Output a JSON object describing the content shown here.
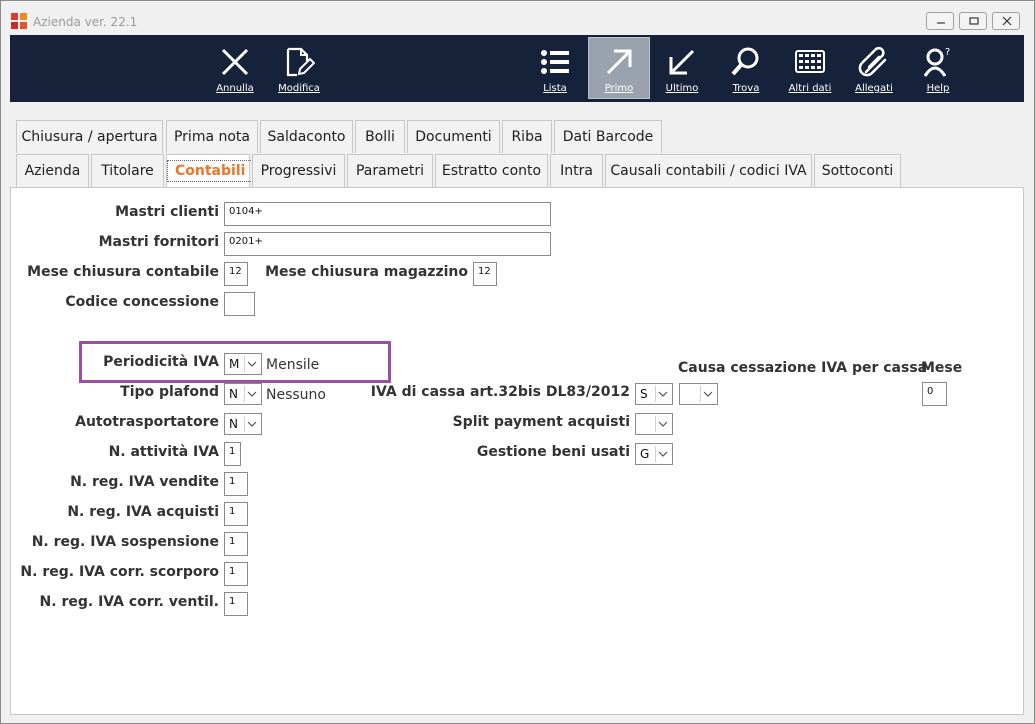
{
  "window": {
    "title": "Azienda ver. 22.1",
    "controls": {
      "minimize": "minimize-icon",
      "restore": "restore-icon",
      "close": "close-icon"
    }
  },
  "toolbar": {
    "annulla": "Annulla",
    "modifica": "Modifica",
    "lista": "Lista",
    "primo": "Primo",
    "ultimo": "Ultimo",
    "trova": "Trova",
    "altri_dati": "Altri dati",
    "allegati": "Allegati",
    "help": "Help",
    "active": "Primo"
  },
  "tabs_row1": [
    "Chiusura / apertura",
    "Prima nota",
    "Saldaconto",
    "Bolli",
    "Documenti",
    "Riba",
    "Dati Barcode"
  ],
  "tabs_row2": [
    "Azienda",
    "Titolare",
    "Contabili",
    "Progressivi",
    "Parametri",
    "Estratto conto",
    "Intra",
    "Causali contabili / codici IVA",
    "Sottoconti"
  ],
  "active_tab": "Contabili",
  "form": {
    "mastri_clienti": {
      "label": "Mastri clienti",
      "value": "0104+"
    },
    "mastri_fornitori": {
      "label": "Mastri fornitori",
      "value": "0201+"
    },
    "mese_chiusura_contabile": {
      "label": "Mese chiusura contabile",
      "value": "12"
    },
    "mese_chiusura_magazzino": {
      "label": "Mese chiusura magazzino",
      "value": "12"
    },
    "codice_concessione": {
      "label": "Codice concessione",
      "value": ""
    },
    "periodicita_iva": {
      "label": "Periodicità IVA",
      "value": "M",
      "description": "Mensile"
    },
    "tipo_plafond": {
      "label": "Tipo plafond",
      "value": "N",
      "description": "Nessuno"
    },
    "autotrasportatore": {
      "label": "Autotrasportatore",
      "value": "N"
    },
    "n_attivita_iva": {
      "label": "N. attività IVA",
      "value": "1"
    },
    "n_reg_iva_vendite": {
      "label": "N. reg. IVA vendite",
      "value": "1"
    },
    "n_reg_iva_acquisti": {
      "label": "N. reg. IVA acquisti",
      "value": "1"
    },
    "n_reg_iva_sospensione": {
      "label": "N. reg. IVA sospensione",
      "value": "1"
    },
    "n_reg_iva_corr_scorporo": {
      "label": "N. reg. IVA corr. scorporo",
      "value": "1"
    },
    "n_reg_iva_corr_ventil": {
      "label": "N. reg. IVA corr. ventil.",
      "value": "1"
    },
    "causa_cessazione": {
      "label": "Causa cessazione IVA per cassa",
      "value": ""
    },
    "mese": {
      "label": "Mese",
      "value": "0"
    },
    "iva_di_cassa": {
      "label": "IVA di cassa art.32bis DL83/2012",
      "value": "S"
    },
    "split_payment": {
      "label": "Split payment acquisti",
      "value": ""
    },
    "gestione_beni_usati": {
      "label": "Gestione beni usati",
      "value": "G"
    }
  },
  "colors": {
    "toolbar_bg": "#16213a",
    "active_tab_text": "#e8762b",
    "highlight_border": "#9b4fa0",
    "active_tool_bg": "#9aa3ad"
  }
}
